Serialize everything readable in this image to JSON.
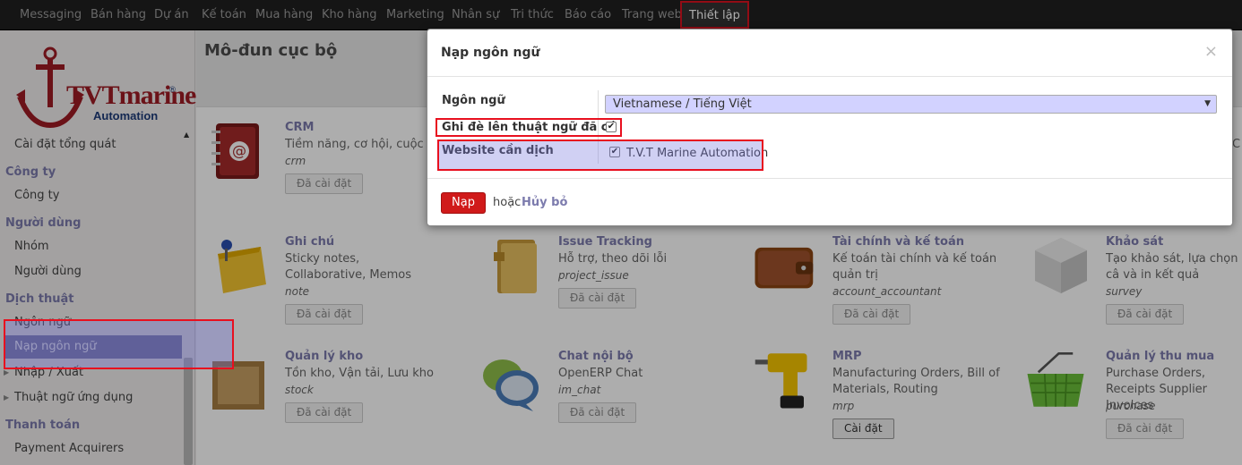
{
  "topbar": {
    "menu": [
      "Messaging",
      "Bán hàng",
      "Dự án",
      "Kế toán",
      "Mua hàng",
      "Kho hàng",
      "Marketing",
      "Nhân sự",
      "Tri thức",
      "Báo cáo",
      "Trang web",
      "Thiết lập"
    ],
    "active_menu": "Thiết lập"
  },
  "logo": {
    "brand": "TVTmarine",
    "registered": "®",
    "sub": "Automation"
  },
  "sidebar": {
    "general_settings": "Cài đặt tổng quát",
    "company_head": "Công ty",
    "company_item": "Công ty",
    "users_head": "Người dùng",
    "groups_item": "Nhóm",
    "users_item": "Người dùng",
    "translation_head": "Dịch thuật",
    "languages_item": "Ngôn ngữ",
    "load_language_item": "Nạp ngôn ngữ",
    "import_export_item": "Nhập / Xuất",
    "app_terms_item": "Thuật ngữ ứng dụng",
    "payment_head": "Thanh toán",
    "payment_acquirers_item": "Payment Acquirers"
  },
  "content": {
    "title": "Mô-đun cục bộ",
    "modules": [
      {
        "name": "CRM",
        "summary": "Tiềm năng, cơ hội, cuộc gọ",
        "tech": "crm",
        "button": "Đã cài đặt",
        "icon": "address-book-icon"
      },
      {
        "name": "Ghi chú",
        "summary": "Sticky notes, Collaborative, Memos",
        "tech": "note",
        "button": "Đã cài đặt",
        "icon": "sticky-note-icon"
      },
      {
        "name": "Issue Tracking",
        "summary": "Hỗ trợ, theo dõi lỗi",
        "tech": "project_issue",
        "button": "Đã cài đặt",
        "icon": "folder-icon"
      },
      {
        "name": "Tài chính và kế toán",
        "summary": "Kế toán tài chính và kế toán quản trị",
        "tech": "account_accountant",
        "button": "Đã cài đặt",
        "icon": "wallet-icon"
      },
      {
        "name": "Khảo sát",
        "summary": "Tạo khảo sát, lựa chọn câ và in kết quả",
        "tech": "survey",
        "button": "Đã cài đặt",
        "icon": "cube-icon"
      },
      {
        "name": "Quản lý kho",
        "summary": "Tồn kho, Vận tải, Lưu kho",
        "tech": "stock",
        "button": "Đã cài đặt",
        "icon": "crate-icon"
      },
      {
        "name": "Chat nội bộ",
        "summary": "OpenERP Chat",
        "tech": "im_chat",
        "button": "Đã cài đặt",
        "icon": "chat-bubbles-icon"
      },
      {
        "name": "MRP",
        "summary": "Manufacturing Orders, Bill of Materials, Routing",
        "tech": "mrp",
        "button": "Cài đặt",
        "icon": "drill-icon"
      },
      {
        "name": "Quản lý thu mua",
        "summary": "Purchase Orders, Receipts Supplier Invoices",
        "tech": "purchase",
        "button": "Đã cài đặt",
        "icon": "basket-icon"
      }
    ],
    "edge_char": "C"
  },
  "dialog": {
    "title": "Nạp ngôn ngữ",
    "close": "×",
    "language_label": "Ngôn ngữ",
    "language_value": "Vietnamese / Tiếng Việt",
    "overwrite_label": "Ghi đè lên thuật ngữ đã có",
    "overwrite_checked": true,
    "website_label": "Website cần dịch",
    "website_option": "T.V.T Marine Automation",
    "website_checked": true,
    "load_button": "Nạp",
    "or_text": "hoặc",
    "cancel_link": "Hủy bỏ"
  },
  "colors": {
    "accent": "#7c7bad",
    "highlight_border": "#e8101f",
    "primary_button": "#d01a1a",
    "topbar": "#1f1f1f"
  }
}
